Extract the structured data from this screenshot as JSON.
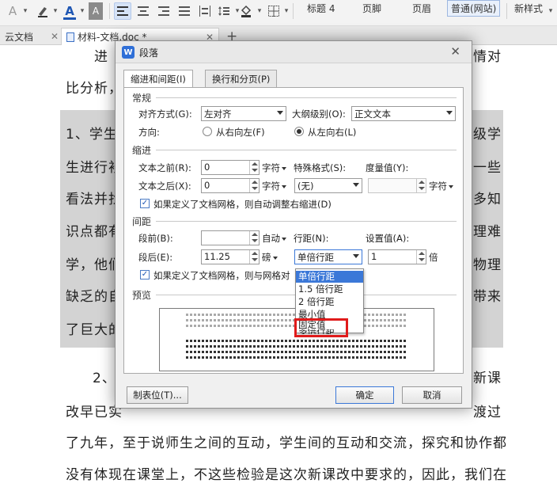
{
  "ribbon": {
    "style_options": [
      "标题 4",
      "页脚",
      "页眉",
      "普通(网站)",
      "新样式"
    ]
  },
  "tabs": [
    {
      "label": "云文档"
    },
    {
      "label": "材料-文档.doc *"
    }
  ],
  "new_tab": "+",
  "document": {
    "lines": [
      "进",
      "情对",
      "比分析，",
      "1、学生",
      "级学",
      "生进行衫",
      "一些",
      "看法并找",
      "多知",
      "识点都有",
      "理难",
      "学，他们",
      "物理",
      "缺乏的自",
      "带来",
      "了巨大的",
      "2、",
      "新课",
      "改早已实",
      "渡过",
      "了九年，至于说师生之间的互动，学生间的互动和交流，探究和协作都",
      "没有体现在课堂上，不这些检验是这次新课改中要求的，因此，我们在"
    ]
  },
  "dialog": {
    "title": "段落",
    "tabs": [
      "缩进和间距(I)",
      "换行和分页(P)"
    ],
    "general": {
      "section": "常规",
      "align_label": "对齐方式(G):",
      "align_value": "左对齐",
      "outline_label": "大纲级别(O):",
      "outline_value": "正文文本",
      "direction_label": "方向:",
      "rtl_label": "从右向左(F)",
      "ltr_label": "从左向右(L)"
    },
    "indent": {
      "section": "缩进",
      "before_label": "文本之前(R):",
      "before_value": "0",
      "before_unit": "字符",
      "after_label": "文本之后(X):",
      "after_value": "0",
      "after_unit": "字符",
      "special_label": "特殊格式(S):",
      "special_value": "(无)",
      "measure_label": "度量值(Y):",
      "measure_unit": "字符",
      "grid_check": "如果定义了文档网格，则自动调整右缩进(D)"
    },
    "spacing": {
      "section": "间距",
      "before_label": "段前(B):",
      "before_value": "",
      "before_unit": "自动",
      "after_label": "段后(E):",
      "after_value": "11.25",
      "after_unit": "磅",
      "line_label": "行距(N):",
      "line_value": "单倍行距",
      "setting_label": "设置值(A):",
      "setting_value": "1",
      "setting_unit": "倍",
      "grid_check": "如果定义了文档网格，则与网格对"
    },
    "line_spacing_options": [
      "单倍行距",
      "1.5 倍行距",
      "2 倍行距",
      "最小值",
      "固定值",
      "多倍行距"
    ],
    "preview_label": "预览",
    "tabs_button": "制表位(T)...",
    "ok_button": "确定",
    "cancel_button": "取消",
    "close": "✕"
  },
  "colors": {
    "highlight": "#d3d3d3",
    "accent": "#3b78d8",
    "annotation": "#e01b1b",
    "font_color": "#1e56b3"
  }
}
